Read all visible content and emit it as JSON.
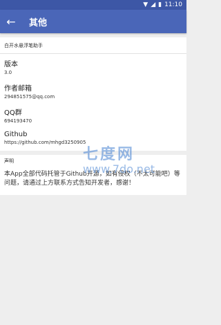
{
  "status": {
    "time": "11:10"
  },
  "toolbar": {
    "back_icon": "back-arrow-icon",
    "title": "其他"
  },
  "app": {
    "name": "白开水悬浮笔助手"
  },
  "items": [
    {
      "label": "版本",
      "value": "3.0"
    },
    {
      "label": "作者邮箱",
      "value": "294851575@qq.com"
    },
    {
      "label": "QQ群",
      "value": "694193470"
    },
    {
      "label": "Github",
      "value": "https://github.com/mhgd3250905"
    }
  ],
  "notice": {
    "title": "声明",
    "text": "本App全部代码托管于Github开源，如有侵权（不太可能吧）等问题，请通过上方联系方式告知开发者，感谢！"
  },
  "watermark": {
    "cn": "七度网",
    "url": "www.7do.net"
  }
}
